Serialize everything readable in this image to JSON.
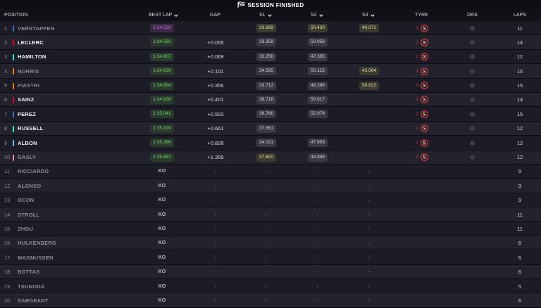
{
  "banner": {
    "title": "SESSION FINISHED"
  },
  "header": {
    "position": "POSITION",
    "best_lap": "BEST LAP",
    "gap": "GAP",
    "s1": "S1",
    "s2": "S2",
    "s3": "S3",
    "tyre": "TYRE",
    "drs": "DRS",
    "laps": "LAPS"
  },
  "colors": {
    "accent_red": "#e0333b",
    "green": "#77d96d",
    "purple": "#c76ce0",
    "background": "#15151e"
  },
  "rows": [
    {
      "pos": "1",
      "driver": "VERSTAPPEN",
      "team_color": "#3671c6",
      "best": "1:34.538",
      "best_style": "purple",
      "gap": "",
      "s1": "33.869",
      "s1_style": "yellow",
      "s2": "50.430",
      "s2_style": "yellow",
      "s3": "40.071",
      "s3_style": "yellow",
      "tyre_age": "3",
      "laps": "11",
      "dim": true
    },
    {
      "pos": "2",
      "driver": "LECLERC",
      "team_color": "#e8002d",
      "best": "1:34.593",
      "best_style": "green",
      "gap": "+0.055",
      "s1": "33.359",
      "s1_style": "gray",
      "s2": "50.956",
      "s2_style": "gray",
      "s3": "",
      "s3_style": "",
      "tyre_age": "2",
      "laps": "14",
      "dim": false
    },
    {
      "pos": "3",
      "driver": "HAMILTON",
      "team_color": "#27f4d2",
      "best": "1:34.607",
      "best_style": "green",
      "gap": "+0.069",
      "s1": "33.256",
      "s1_style": "gray",
      "s2": "47.395",
      "s2_style": "gray",
      "s3": "",
      "s3_style": "",
      "tyre_age": "2",
      "laps": "12",
      "dim": false
    },
    {
      "pos": "4",
      "driver": "NORRIS",
      "team_color": "#ff8000",
      "best": "1:34.639",
      "best_style": "green",
      "gap": "+0.101",
      "s1": "34.565",
      "s1_style": "gray",
      "s2": "50.115",
      "s2_style": "gray",
      "s3": "43.064",
      "s3_style": "yellow",
      "tyre_age": "3",
      "laps": "15",
      "dim": true
    },
    {
      "pos": "5",
      "driver": "PIASTRI",
      "team_color": "#ff8000",
      "best": "1:34.894",
      "best_style": "green",
      "gap": "+0.356",
      "s1": "33.713",
      "s1_style": "gray",
      "s2": "49.286",
      "s2_style": "gray",
      "s3": "50.822",
      "s3_style": "yellow",
      "tyre_age": "3",
      "laps": "15",
      "dim": true
    },
    {
      "pos": "6",
      "driver": "SAINZ",
      "team_color": "#e8002d",
      "best": "1:34.939",
      "best_style": "green",
      "gap": "+0.401",
      "s1": "38.718",
      "s1_style": "gray",
      "s2": "50.617",
      "s2_style": "gray",
      "s3": "",
      "s3_style": "",
      "tyre_age": "2",
      "laps": "14",
      "dim": false
    },
    {
      "pos": "7",
      "driver": "PEREZ",
      "team_color": "#3671c6",
      "best": "1:35.041",
      "best_style": "green",
      "gap": "+0.503",
      "s1": "36.766",
      "s1_style": "gray",
      "s2": "52.074",
      "s2_style": "gray",
      "s3": "",
      "s3_style": "",
      "tyre_age": "2",
      "laps": "15",
      "dim": false
    },
    {
      "pos": "8",
      "driver": "RUSSELL",
      "team_color": "#27f4d2",
      "best": "1:35.199",
      "best_style": "green",
      "gap": "+0.661",
      "s1": "37.561",
      "s1_style": "gray",
      "s2": "",
      "s2_style": "",
      "s3": "",
      "s3_style": "",
      "tyre_age": "2",
      "laps": "12",
      "dim": false
    },
    {
      "pos": "9",
      "driver": "ALBON",
      "team_color": "#64c4ff",
      "best": "1:35.366",
      "best_style": "green",
      "gap": "+0.828",
      "s1": "34.021",
      "s1_style": "gray",
      "s2": "47.959",
      "s2_style": "gray",
      "s3": "",
      "s3_style": "",
      "tyre_age": "2",
      "laps": "12",
      "dim": false
    },
    {
      "pos": "10",
      "driver": "GASLY",
      "team_color": "#ff87bc",
      "best": "1:35.897",
      "best_style": "green",
      "gap": "+1.359",
      "s1": "37.600",
      "s1_style": "yellow",
      "s2": "44.999",
      "s2_style": "gray",
      "s3": "",
      "s3_style": "",
      "tyre_age": "2",
      "laps": "12",
      "dim": true
    },
    {
      "pos": "11",
      "driver": "RICCIARDO",
      "team_color": "",
      "best": "KO",
      "gap": "-",
      "s1": "-",
      "s2": "-",
      "s3": "-",
      "tyre_age": "",
      "laps": "9",
      "dim": true,
      "ko": true
    },
    {
      "pos": "12",
      "driver": "ALONSO",
      "team_color": "",
      "best": "KO",
      "gap": "-",
      "s1": "-",
      "s2": "-",
      "s3": "-",
      "tyre_age": "",
      "laps": "9",
      "dim": true,
      "ko": true
    },
    {
      "pos": "13",
      "driver": "OCON",
      "team_color": "",
      "best": "KO",
      "gap": "-",
      "s1": "-",
      "s2": "-",
      "s3": "-",
      "tyre_age": "",
      "laps": "9",
      "dim": true,
      "ko": true
    },
    {
      "pos": "14",
      "driver": "STROLL",
      "team_color": "",
      "best": "KO",
      "gap": "-",
      "s1": "-",
      "s2": "-",
      "s3": "-",
      "tyre_age": "",
      "laps": "11",
      "dim": true,
      "ko": true
    },
    {
      "pos": "15",
      "driver": "ZHOU",
      "team_color": "",
      "best": "KO",
      "gap": "-",
      "s1": "-",
      "s2": "-",
      "s3": "-",
      "tyre_age": "",
      "laps": "11",
      "dim": true,
      "ko": true
    },
    {
      "pos": "16",
      "driver": "HULKENBERG",
      "team_color": "",
      "best": "KO",
      "gap": "-",
      "s1": "-",
      "s2": "-",
      "s3": "-",
      "tyre_age": "",
      "laps": "6",
      "dim": true,
      "ko": true
    },
    {
      "pos": "17",
      "driver": "MAGNUSSEN",
      "team_color": "",
      "best": "KO",
      "gap": "-",
      "s1": "-",
      "s2": "-",
      "s3": "-",
      "tyre_age": "",
      "laps": "6",
      "dim": true,
      "ko": true
    },
    {
      "pos": "18",
      "driver": "BOTTAS",
      "team_color": "",
      "best": "KO",
      "gap": "-",
      "s1": "-",
      "s2": "-",
      "s3": "-",
      "tyre_age": "",
      "laps": "6",
      "dim": true,
      "ko": true
    },
    {
      "pos": "19",
      "driver": "TSUNODA",
      "team_color": "",
      "best": "KO",
      "gap": "-",
      "s1": "-",
      "s2": "-",
      "s3": "-",
      "tyre_age": "",
      "laps": "5",
      "dim": true,
      "ko": true
    },
    {
      "pos": "20",
      "driver": "SARGEANT",
      "team_color": "",
      "best": "KO",
      "gap": "-",
      "s1": "-",
      "s2": "-",
      "s3": "-",
      "tyre_age": "",
      "laps": "6",
      "dim": true,
      "ko": true
    }
  ]
}
